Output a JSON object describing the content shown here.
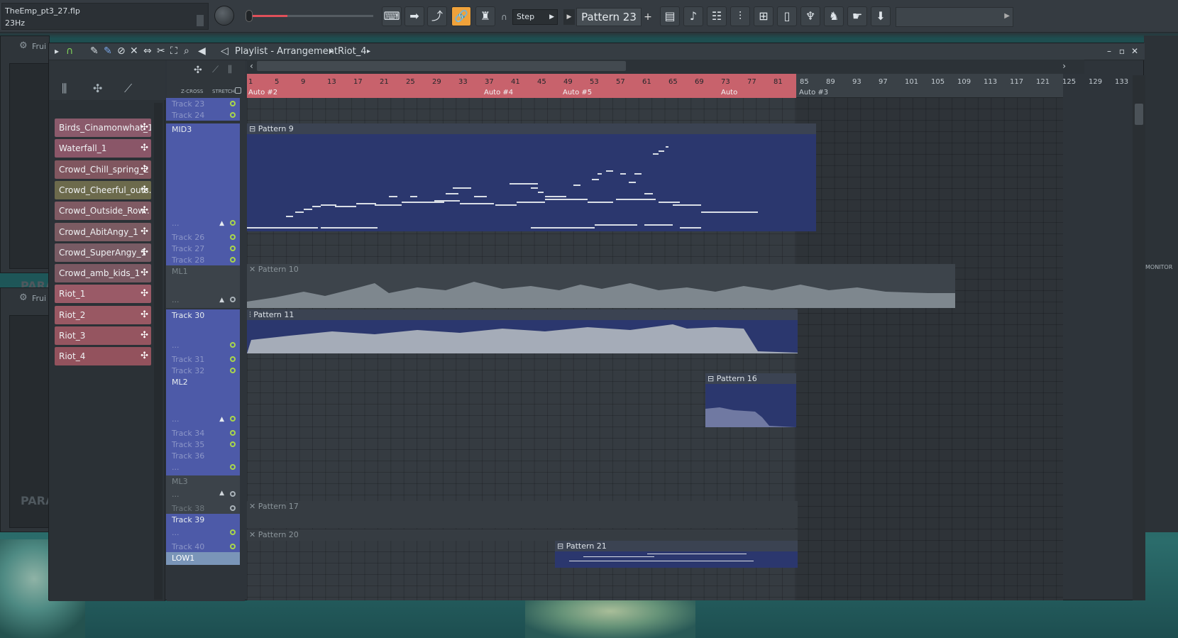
{
  "toolbar": {
    "file_name": "TheEmp_pt3_27.flp",
    "hint": "23Hz",
    "step_label": "Step",
    "pattern_label": "Pattern 23",
    "add_label": "+"
  },
  "background_windows": {
    "title_1": "Frui",
    "title_2": "Frui",
    "para_1": "PARA",
    "para_2": "PARA",
    "monitor": "MONITOR"
  },
  "playlist": {
    "title": "Playlist - Arrangement",
    "breadcrumb_item": "Riot_4",
    "crossfade_label": "Z-CROSS",
    "stretch_label": "STRETCH"
  },
  "picker_clips": [
    {
      "label": "Birds_Cinamonwhat_1",
      "color": "#8a5a6b"
    },
    {
      "label": "Waterfall_1",
      "color": "#8a5668"
    },
    {
      "label": "Crowd_Chill_spring_2",
      "color": "#80565f"
    },
    {
      "label": "Crowd_Cheerful_outs..",
      "color": "#6c6a4c"
    },
    {
      "label": "Crowd_Outside_Row..",
      "color": "#7f5a63"
    },
    {
      "label": "Crowd_AbitAngy_1",
      "color": "#7b5b62"
    },
    {
      "label": "Crowd_SuperAngy_1",
      "color": "#785b64"
    },
    {
      "label": "Crowd_amb_kids_1",
      "color": "#7a5862"
    },
    {
      "label": "Riot_1",
      "color": "#9a5a67"
    },
    {
      "label": "Riot_2",
      "color": "#995863"
    },
    {
      "label": "Riot_3",
      "color": "#955560"
    },
    {
      "label": "Riot_4",
      "color": "#93525d"
    }
  ],
  "ruler": {
    "ticks": [
      "1",
      "5",
      "9",
      "13",
      "17",
      "21",
      "25",
      "29",
      "33",
      "37",
      "41",
      "45",
      "49",
      "53",
      "57",
      "61",
      "65",
      "69",
      "73",
      "77",
      "81",
      "85",
      "89",
      "93",
      "97",
      "101",
      "105",
      "109",
      "113",
      "117",
      "121",
      "125",
      "129",
      "133"
    ],
    "automation": [
      "Auto #2",
      "Auto #4",
      "Auto #5",
      "Auto",
      "Auto #3"
    ]
  },
  "tracks": {
    "t23": "Track 23",
    "t24": "Track 24",
    "mid3": "MID3",
    "dots1": "...",
    "t26": "Track 26",
    "t27": "Track 27",
    "t28": "Track 28",
    "ml1": "ML1",
    "dots2": "...",
    "t30": "Track 30",
    "dots3": "...",
    "t31": "Track 31",
    "t32": "Track 32",
    "ml2": "ML2",
    "dots4": "...",
    "t34": "Track 34",
    "t35": "Track 35",
    "t36": "Track 36",
    "dots5": "...",
    "ml3": "ML3",
    "dots6": "...",
    "t38": "Track 38",
    "t39": "Track 39",
    "dots7": "...",
    "t40": "Track 40",
    "low1": "LOW1"
  },
  "patterns": {
    "p9": "Pattern 9",
    "p10": "Pattern 10",
    "p11": "Pattern 11",
    "p16": "Pattern 16",
    "p17": "Pattern 17",
    "p20": "Pattern 20",
    "p21": "Pattern 21"
  },
  "colors": {
    "accent_orange": "#f0a23a",
    "ruler_red": "#c8626c",
    "track_blue": "#4d5aa8",
    "pattern_blue": "#2b376e"
  }
}
